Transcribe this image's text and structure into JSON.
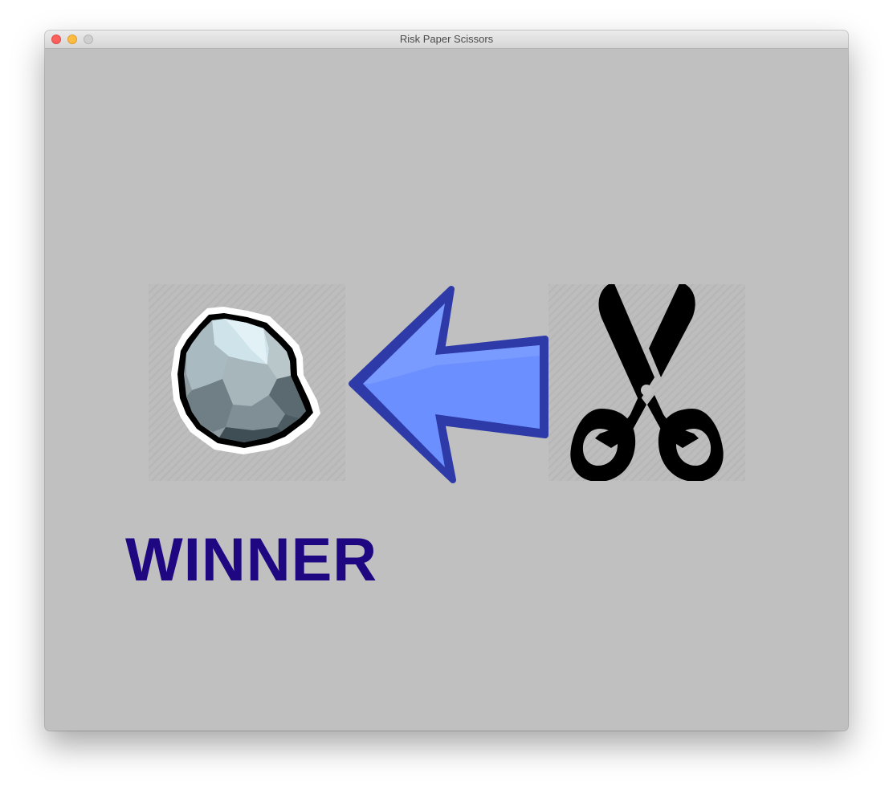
{
  "window": {
    "title": "Risk Paper Scissors",
    "background_color": "#c0c0c0"
  },
  "game": {
    "left_choice_icon": "rock-icon",
    "right_choice_icon": "scissors-icon",
    "arrow_icon": "left-arrow-icon",
    "arrow_color": "#6b8ffe",
    "result_text": "WINNER",
    "result_color": "#1f0782"
  }
}
